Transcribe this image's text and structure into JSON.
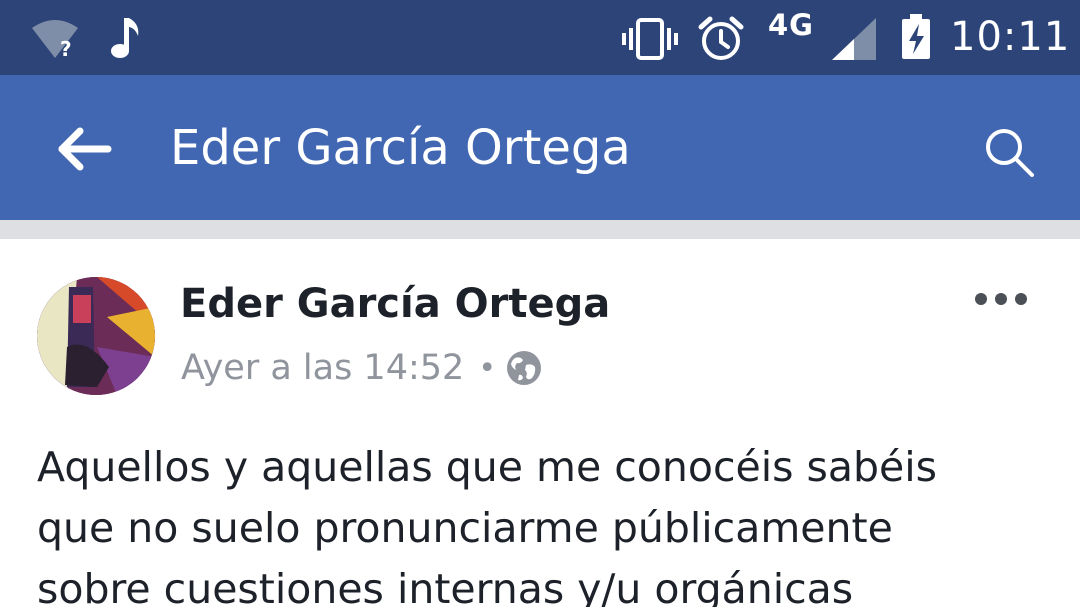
{
  "status_bar": {
    "network_type": "4G",
    "time": "10:11",
    "icons": [
      "wifi-unknown-icon",
      "music-note-icon",
      "vibrate-icon",
      "alarm-clock-icon",
      "cell-signal-icon",
      "battery-charging-icon"
    ]
  },
  "app_bar": {
    "title": "Eder García Ortega",
    "icons": [
      "arrow-left-icon",
      "search-icon"
    ],
    "color": "#4267b2"
  },
  "status_bar_color": "#2d4479",
  "post": {
    "author": "Eder García Ortega",
    "timestamp": "Ayer a las 14:52",
    "separator": "•",
    "privacy_icon": "globe-icon",
    "more_icon": "more-dots-icon",
    "text_lines": [
      "Aquellos y aquellas que me conocéis sabéis",
      "que no suelo pronunciarme públicamente",
      "sobre cuestiones internas y/u orgánicas"
    ]
  }
}
